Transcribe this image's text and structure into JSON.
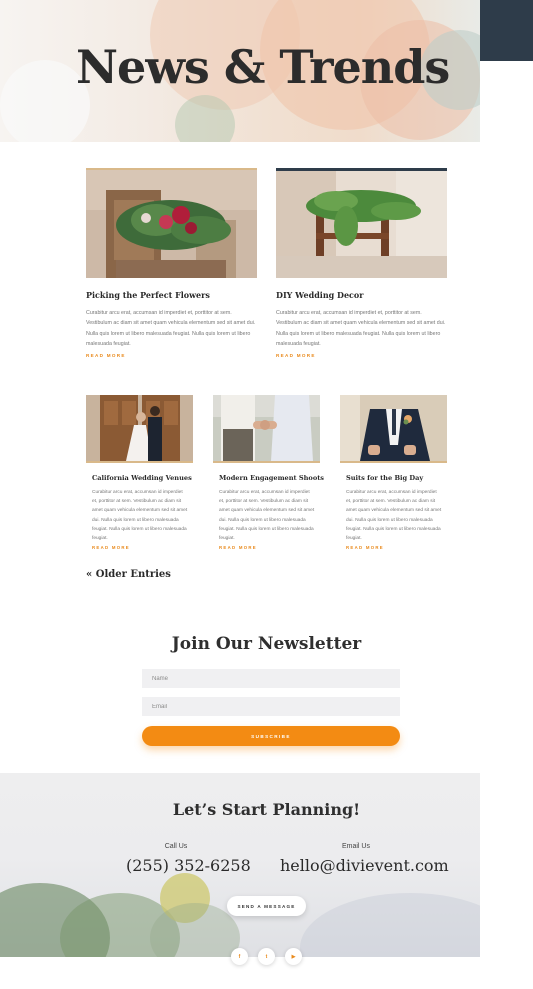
{
  "hero": {
    "title": "News & Trends"
  },
  "featured_posts": [
    {
      "title": "Picking the Perfect Flowers",
      "excerpt": "Curabitur arcu erat, accumsan id imperdiet et, porttitor at sem. Vestibulum ac diam sit amet quam vehicula elementum sed sit amet dui. Nulla quis lorem ut libero malesuada feugiat. Nulla quis lorem ut libero malesuada feugiat.",
      "read_more": "READ MORE",
      "image": "floral-centerpiece-image",
      "accent_color": "#d9b98a"
    },
    {
      "title": "DIY Wedding Decor",
      "excerpt": "Curabitur arcu erat, accumsan id imperdiet et, porttitor at sem. Vestibulum ac diam sit amet quam vehicula elementum sed sit amet dui. Nulla quis lorem ut libero malesuada feugiat. Nulla quis lorem ut libero malesuada feugiat.",
      "read_more": "READ MORE",
      "image": "chair-greenery-image",
      "accent_color": "#2e3c4a"
    }
  ],
  "posts": [
    {
      "title": "California Wedding Venues",
      "excerpt": "Curabitur arcu erat, accumsan id imperdiet et, porttitor at sem. Vestibulum ac diam sit amet quam vehicula elementum sed sit amet dui. Nulla quis lorem ut libero malesuada feugiat. Nulla quis lorem ut libero malesuada feugiat.",
      "read_more": "READ MORE",
      "image": "couple-at-door-image"
    },
    {
      "title": "Modern Engagement Shoots",
      "excerpt": "Curabitur arcu erat, accumsan id imperdiet et, porttitor at sem. Vestibulum ac diam sit amet quam vehicula elementum sed sit amet dui. Nulla quis lorem ut libero malesuada feugiat. Nulla quis lorem ut libero malesuada feugiat.",
      "read_more": "READ MORE",
      "image": "holding-hands-image"
    },
    {
      "title": "Suits for the Big Day",
      "excerpt": "Curabitur arcu erat, accumsan id imperdiet et, porttitor at sem. Vestibulum ac diam sit amet quam vehicula elementum sed sit amet dui. Nulla quis lorem ut libero malesuada feugiat. Nulla quis lorem ut libero malesuada feugiat.",
      "read_more": "READ MORE",
      "image": "groom-suit-image"
    }
  ],
  "pagination": {
    "older_entries": "« Older Entries"
  },
  "newsletter": {
    "title": "Join Our Newsletter",
    "name_placeholder": "Name",
    "email_placeholder": "Email",
    "subscribe_label": "SUBSCRIBE"
  },
  "planning": {
    "title": "Let’s Start Planning!",
    "call_label": "Call Us",
    "phone": "(255) 352-6258",
    "email_label": "Email Us",
    "email": "hello@divievent.com",
    "send_label": "SEND A MESSAGE"
  },
  "social": [
    {
      "icon": "facebook-icon",
      "glyph": "f"
    },
    {
      "icon": "twitter-icon",
      "glyph": "t"
    },
    {
      "icon": "youtube-icon",
      "glyph": "▶"
    }
  ],
  "colors": {
    "accent": "#f38b13",
    "dark": "#2e3c4a",
    "link": "#e98a1c"
  }
}
